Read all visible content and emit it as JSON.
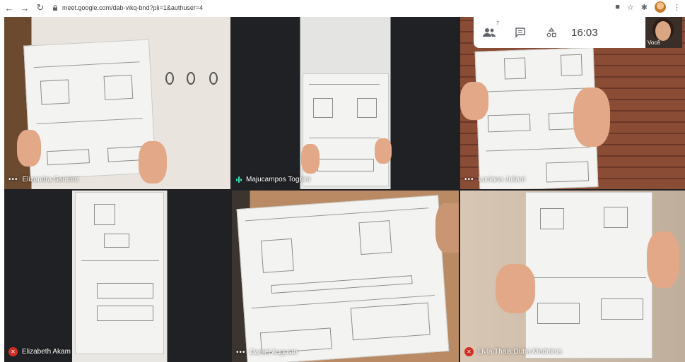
{
  "browser": {
    "url": "meet.google.com/dab-vikq-bnd?pli=1&authuser=4",
    "back_icon": "arrow-left-icon",
    "forward_icon": "arrow-right-icon",
    "reload_icon": "reload-icon"
  },
  "meet_bar": {
    "participants_count": "7",
    "time": "16:03",
    "self_label": "Você"
  },
  "participants": [
    {
      "name": "Elizandra Santoro",
      "status": "more"
    },
    {
      "name": "Majucampos Tognini",
      "status": "speaking"
    },
    {
      "name": "Luciana Juliani",
      "status": "more"
    },
    {
      "name": "Elizabeth Akam",
      "status": "muted"
    },
    {
      "name": "Daniel Augusto",
      "status": "more"
    },
    {
      "name": "Livia Thais Dutra Medeiros",
      "status": "muted"
    }
  ],
  "colors": {
    "muted": "#d93025",
    "speaking": "#34e3b4",
    "stage_bg": "#202124"
  }
}
